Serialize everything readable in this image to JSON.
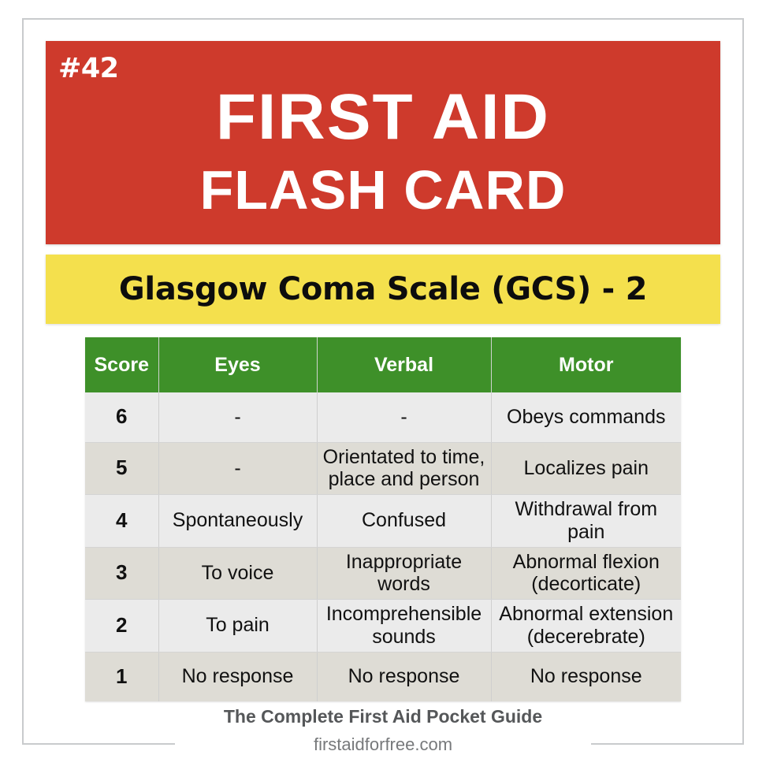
{
  "card": {
    "number_badge": "#42",
    "title_main": "FIRST AID",
    "title_sub": "FLASH CARD",
    "subtitle": "Glasgow Coma Scale (GCS) - 2"
  },
  "colors": {
    "header_red": "#CE3A2C",
    "subtitle_yellow": "#F4E04D",
    "table_header_green": "#3E9029",
    "row_odd": "#EBEBEB",
    "row_even": "#DEDCD5",
    "frame_gray": "#C9CBCD",
    "footer_text": "#555759"
  },
  "table": {
    "columns": [
      "Score",
      "Eyes",
      "Verbal",
      "Motor"
    ],
    "rows": [
      {
        "score": "6",
        "eyes": "-",
        "verbal": "-",
        "motor": "Obeys commands"
      },
      {
        "score": "5",
        "eyes": "-",
        "verbal": "Orientated to time, place and person",
        "motor": "Localizes pain"
      },
      {
        "score": "4",
        "eyes": "Spontaneously",
        "verbal": "Confused",
        "motor": "Withdrawal from pain"
      },
      {
        "score": "3",
        "eyes": "To voice",
        "verbal": "Inappropriate words",
        "motor": "Abnormal flexion (decorticate)"
      },
      {
        "score": "2",
        "eyes": "To pain",
        "verbal": "Incomprehensible sounds",
        "motor": "Abnormal extension (decerebrate)"
      },
      {
        "score": "1",
        "eyes": "No response",
        "verbal": "No response",
        "motor": "No response"
      }
    ]
  },
  "footer": {
    "title": "The Complete First Aid Pocket Guide",
    "url": "firstaidforfree.com"
  }
}
